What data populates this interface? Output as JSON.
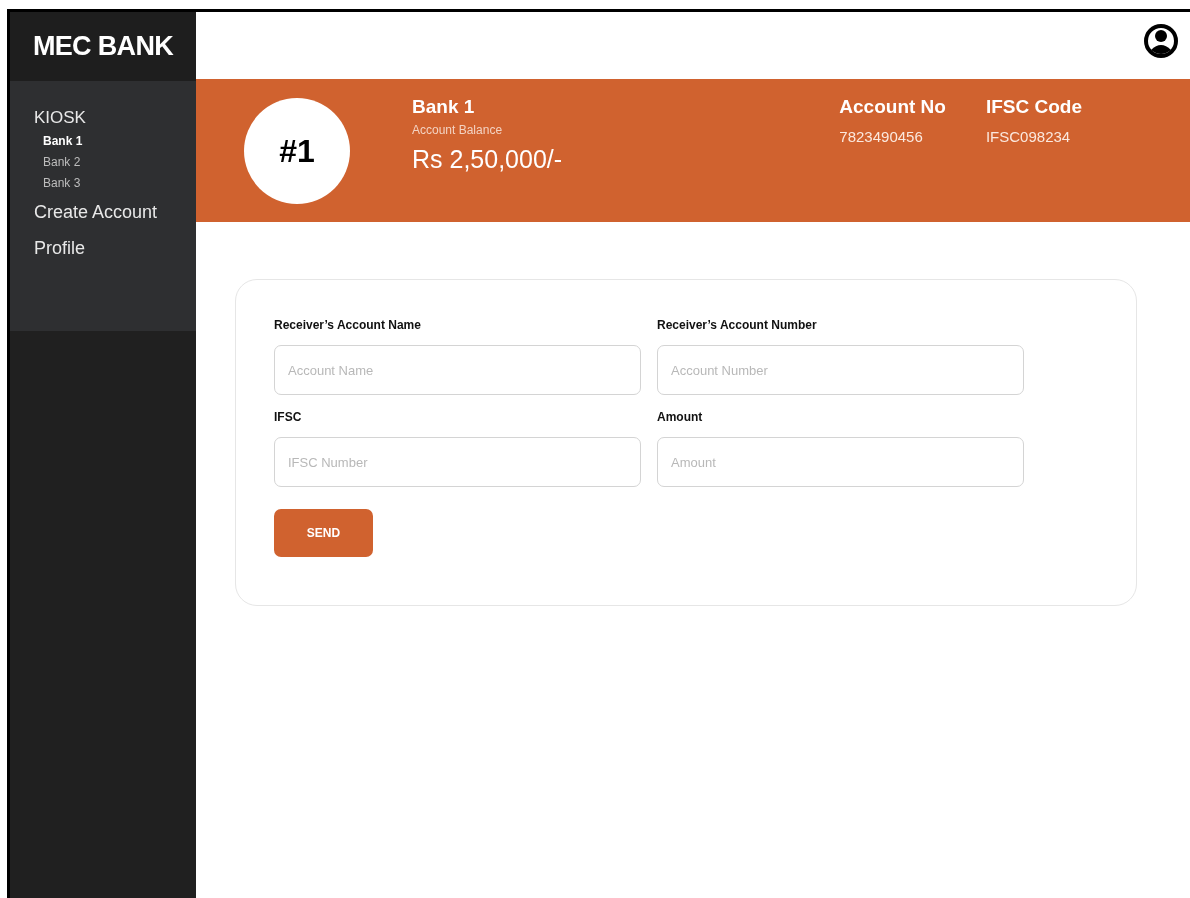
{
  "sidebar": {
    "brand": "MEC BANK",
    "items": [
      {
        "label": "KIOSK",
        "selected": false,
        "children": [
          {
            "label": "Bank 1",
            "selected": true
          },
          {
            "label": "Bank 2",
            "selected": false
          },
          {
            "label": "Bank 3",
            "selected": false
          }
        ]
      },
      {
        "label": "Create Account",
        "selected": false
      },
      {
        "label": "Profile",
        "selected": false
      }
    ]
  },
  "banner": {
    "badge": "#1",
    "bank_name": "Bank 1",
    "balance_label": "Account Balance",
    "balance": "Rs 2,50,000/-",
    "details": [
      {
        "label": "Account No",
        "value": "7823490456"
      },
      {
        "label": "IFSC Code",
        "value": "IFSC098234"
      }
    ]
  },
  "form": {
    "fields": [
      {
        "label": "Receiver’s Account Name",
        "placeholder": "Account Name"
      },
      {
        "label": "Receiver’s Account Number",
        "placeholder": "Account Number"
      },
      {
        "label": "IFSC",
        "placeholder": "IFSC Number"
      },
      {
        "label": "Amount",
        "placeholder": "Amount"
      }
    ],
    "button": "SEND"
  }
}
